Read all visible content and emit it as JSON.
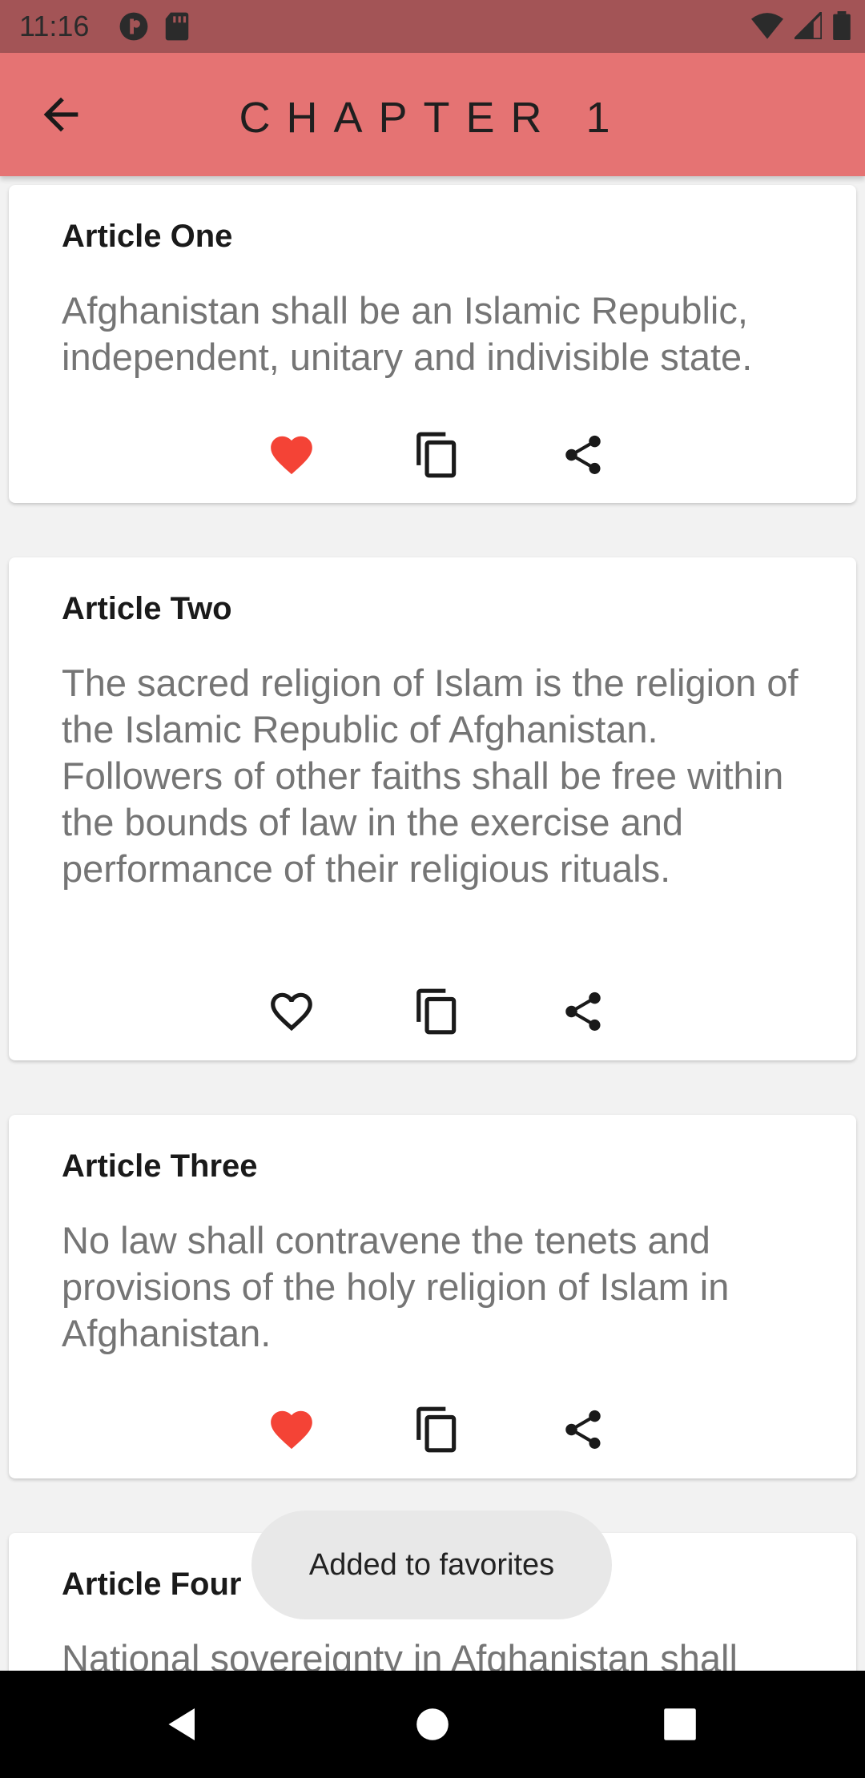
{
  "status_bar": {
    "time": "11:16"
  },
  "app_bar": {
    "title": "CHAPTER 1"
  },
  "articles": [
    {
      "title": "Article One",
      "text": "Afghanistan shall be an Islamic Republic, independent, unitary and indivisible state.",
      "favorite": true
    },
    {
      "title": "Article Two",
      "text": "The sacred religion of Islam is the religion of the Islamic Republic of Afghanistan. Followers of other faiths shall be free within the bounds of law in the exercise and performance of their religious rituals.",
      "favorite": false
    },
    {
      "title": "Article Three",
      "text": "No law shall contravene the tenets and provisions of the holy religion of Islam in Afghanistan.",
      "favorite": true
    },
    {
      "title": "Article Four",
      "text": "National sovereignty in Afghanistan shall",
      "favorite": false
    }
  ],
  "toast": {
    "message": "Added to favorites"
  },
  "colors": {
    "favorite": "#f44336",
    "app_bar": "#e57373",
    "status_bar": "#a35456"
  },
  "icons": [
    "back-arrow-icon",
    "heart-icon",
    "copy-icon",
    "share-icon"
  ]
}
